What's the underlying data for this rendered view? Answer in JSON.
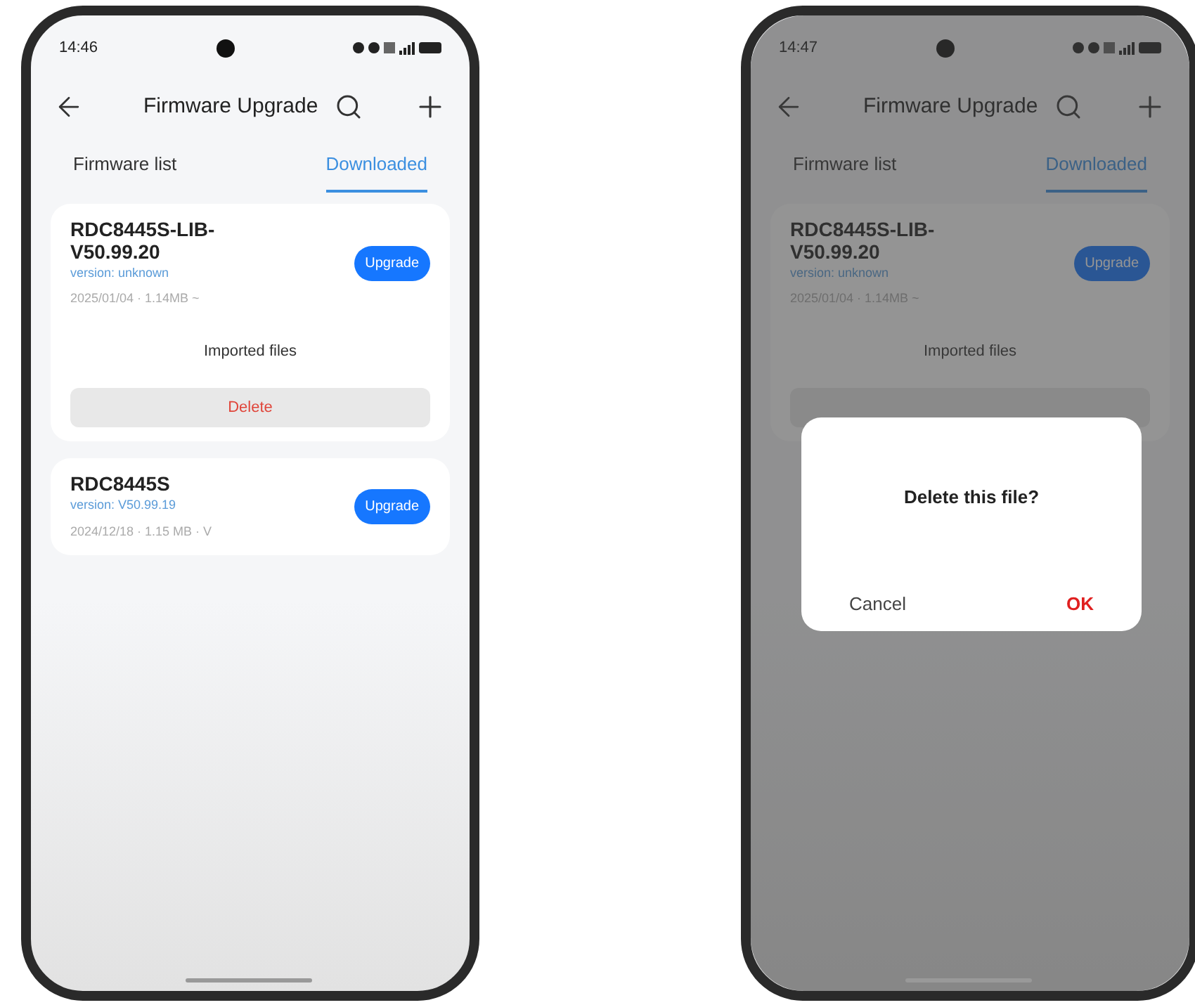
{
  "phones": [
    {
      "time": "14:46",
      "title": "Firmware Upgrade",
      "tabs": [
        {
          "label": "Firmware list",
          "selected": false
        },
        {
          "label": "Downloaded",
          "selected": true
        }
      ],
      "files": [
        {
          "name": "RDC8445S-LIB-V50.99.20",
          "version": "version: unknown",
          "meta": "2025/01/04 · 1.14MB ~",
          "action": "Upgrade",
          "expanded": true
        },
        {
          "name": "RDC8445S",
          "version": "version: V50.99.19",
          "meta": "2024/12/18 · 1.15 MB · V",
          "action": "Upgrade",
          "expanded": false
        }
      ],
      "sheet": {
        "title": "Imported files",
        "delete": "Delete"
      }
    },
    {
      "time": "14:47",
      "title": "Firmware Upgrade",
      "tabs": [
        {
          "label": "Firmware list",
          "selected": false
        },
        {
          "label": "Downloaded",
          "selected": true
        }
      ],
      "files": [
        {
          "name": "RDC8445S-LIB-V50.99.20",
          "version": "version: unknown",
          "meta": "2025/01/04 · 1.14MB ~",
          "action": "Upgrade",
          "expanded": true
        }
      ],
      "sheet": {
        "title": "Imported files"
      },
      "dialog": {
        "message": "Delete this file?",
        "cancel": "Cancel",
        "ok": "OK"
      }
    }
  ]
}
